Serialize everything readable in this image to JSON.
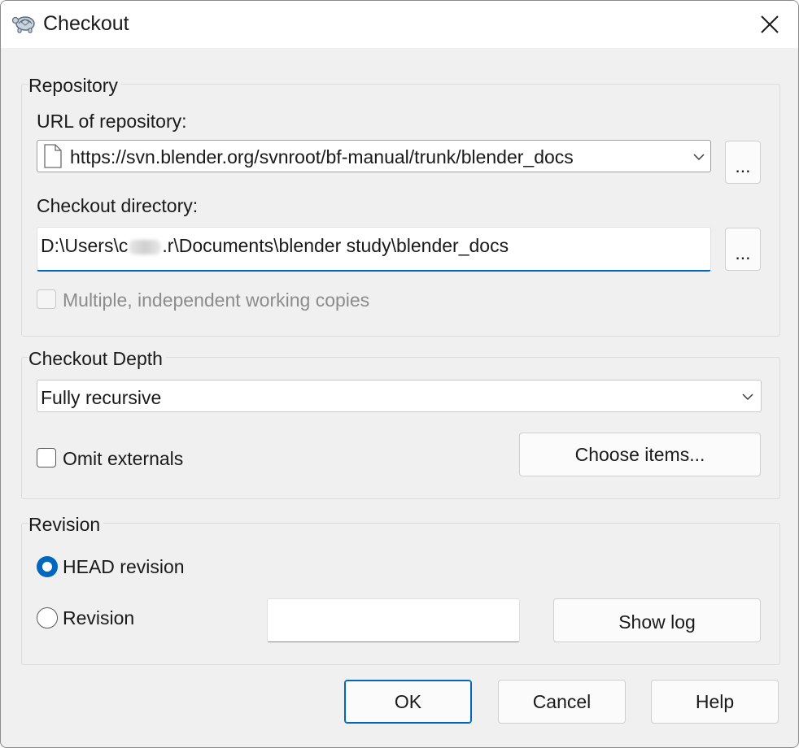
{
  "window": {
    "title": "Checkout",
    "app_icon": "tortoise-icon",
    "close_icon": "close-icon"
  },
  "repository": {
    "group_label": "Repository",
    "url_label": "URL of repository:",
    "url_value": "https://svn.blender.org/svnroot/bf-manual/trunk/blender_docs",
    "url_icon": "file-icon",
    "url_browse_label": "...",
    "dir_label": "Checkout directory:",
    "dir_value_prefix": "D:\\Users\\c",
    "dir_value_suffix": ".r\\Documents\\blender study\\blender_docs",
    "dir_browse_label": "...",
    "multiple_copies_label": "Multiple, independent working copies",
    "multiple_copies_checked": false,
    "multiple_copies_enabled": false
  },
  "depth": {
    "group_label": "Checkout Depth",
    "selected": "Fully recursive",
    "omit_externals_label": "Omit externals",
    "omit_externals_checked": false,
    "choose_items_label": "Choose items..."
  },
  "revision": {
    "group_label": "Revision",
    "head_label": "HEAD revision",
    "head_selected": true,
    "revision_label": "Revision",
    "revision_value": "",
    "show_log_label": "Show log"
  },
  "buttons": {
    "ok": "OK",
    "cancel": "Cancel",
    "help": "Help"
  },
  "colors": {
    "accent": "#0067c0",
    "dialog_bg": "#f0f0f0",
    "titlebar_bg": "#ffffff"
  }
}
